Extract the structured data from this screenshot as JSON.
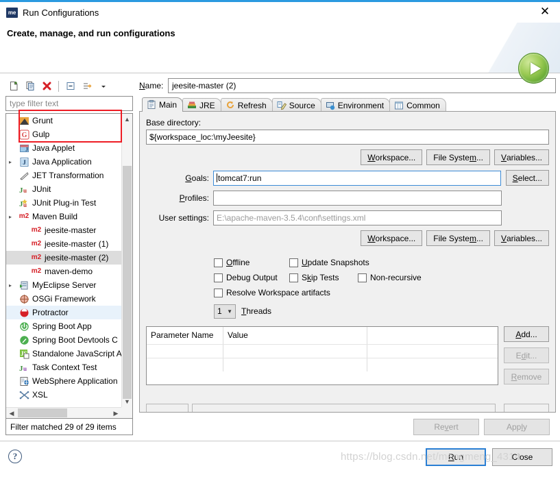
{
  "window": {
    "app_icon": "myeclipse-icon",
    "title": "Run Configurations",
    "close_label": "✕"
  },
  "banner": {
    "heading": "Create, manage, and run configurations",
    "icon": "run-play-icon"
  },
  "left": {
    "toolbar": [
      {
        "name": "new-configuration-button",
        "icon": "new-document-icon"
      },
      {
        "name": "duplicate-configuration-button",
        "icon": "copy-icon"
      },
      {
        "name": "delete-configuration-button",
        "icon": "delete-red-x-icon"
      },
      {
        "name": "collapse-all-button",
        "icon": "collapse-all-icon"
      },
      {
        "name": "filter-configurations-button",
        "icon": "filter-arrow-icon"
      },
      {
        "name": "view-menu-button",
        "icon": "chevron-down-icon"
      }
    ],
    "filter": {
      "placeholder": "type filter text",
      "value": ""
    },
    "tree": [
      {
        "label": "Grunt",
        "icon": "grunt-icon",
        "level": 0,
        "state": "normal"
      },
      {
        "label": "Gulp",
        "icon": "gulp-icon",
        "level": 0,
        "state": "normal"
      },
      {
        "label": "Java Applet",
        "icon": "java-applet-icon",
        "level": 0,
        "state": "normal"
      },
      {
        "label": "Java Application",
        "icon": "java-application-icon",
        "level": 0,
        "state": "normal",
        "expandable": true
      },
      {
        "label": "JET Transformation",
        "icon": "jet-transformation-icon",
        "level": 0,
        "state": "normal"
      },
      {
        "label": "JUnit",
        "icon": "junit-icon",
        "level": 0,
        "state": "normal"
      },
      {
        "label": "JUnit Plug-in Test",
        "icon": "junit-plugin-test-icon",
        "level": 0,
        "state": "normal"
      },
      {
        "label": "Maven Build",
        "icon": "maven-icon",
        "level": 0,
        "state": "normal",
        "expandable": true
      },
      {
        "label": "jeesite-master",
        "icon": "maven-icon",
        "level": 1,
        "state": "normal"
      },
      {
        "label": "jeesite-master (1)",
        "icon": "maven-icon",
        "level": 1,
        "state": "normal"
      },
      {
        "label": "jeesite-master (2)",
        "icon": "maven-icon",
        "level": 1,
        "state": "selected"
      },
      {
        "label": "maven-demo",
        "icon": "maven-icon",
        "level": 1,
        "state": "normal"
      },
      {
        "label": "MyEclipse Server",
        "icon": "myeclipse-server-icon",
        "level": 0,
        "state": "normal",
        "expandable": true
      },
      {
        "label": "OSGi Framework",
        "icon": "osgi-icon",
        "level": 0,
        "state": "normal"
      },
      {
        "label": "Protractor",
        "icon": "protractor-icon",
        "level": 0,
        "state": "hover"
      },
      {
        "label": "Spring Boot App",
        "icon": "spring-boot-icon",
        "level": 0,
        "state": "normal"
      },
      {
        "label": "Spring Boot Devtools C",
        "icon": "spring-boot-devtools-icon",
        "level": 0,
        "state": "normal"
      },
      {
        "label": "Standalone JavaScript A",
        "icon": "javascript-icon",
        "level": 0,
        "state": "normal"
      },
      {
        "label": "Task Context Test",
        "icon": "task-context-test-icon",
        "level": 0,
        "state": "normal"
      },
      {
        "label": "WebSphere Application",
        "icon": "websphere-icon",
        "level": 0,
        "state": "normal"
      },
      {
        "label": "XSL",
        "icon": "xsl-icon",
        "level": 0,
        "state": "normal"
      }
    ],
    "status": "Filter matched 29 of 29 items"
  },
  "right": {
    "name_label": "Name:",
    "name_value": "jeesite-master (2)",
    "tabs": [
      {
        "label": "Main",
        "icon": "main-tab-icon",
        "active": true
      },
      {
        "label": "JRE",
        "icon": "jre-tab-icon",
        "active": false
      },
      {
        "label": "Refresh",
        "icon": "refresh-tab-icon",
        "active": false
      },
      {
        "label": "Source",
        "icon": "source-tab-icon",
        "active": false
      },
      {
        "label": "Environment",
        "icon": "environment-tab-icon",
        "active": false
      },
      {
        "label": "Common",
        "icon": "common-tab-icon",
        "active": false
      }
    ],
    "main": {
      "base_directory_label": "Base directory:",
      "base_directory_value": "${workspace_loc:\\myJeesite}",
      "dir_buttons": [
        {
          "label": "Workspace...",
          "name": "base-workspace-button"
        },
        {
          "label": "File System...",
          "name": "base-file-system-button"
        },
        {
          "label": "Variables...",
          "name": "base-variables-button"
        }
      ],
      "goals_label": "Goals:",
      "goals_value": "tomcat7:run",
      "goals_select_label": "Select...",
      "profiles_label": "Profiles:",
      "profiles_value": "",
      "user_settings_label": "User settings:",
      "user_settings_placeholder": "E:\\apache-maven-3.5.4\\conf\\settings.xml",
      "settings_buttons": [
        {
          "label": "Workspace...",
          "name": "settings-workspace-button"
        },
        {
          "label": "File System...",
          "name": "settings-file-system-button"
        },
        {
          "label": "Variables...",
          "name": "settings-variables-button"
        }
      ],
      "checkboxes": [
        {
          "label": "Offline",
          "checked": false,
          "name": "offline-checkbox"
        },
        {
          "label": "Update Snapshots",
          "checked": false,
          "name": "update-snapshots-checkbox"
        },
        {
          "label": "Debug Output",
          "checked": false,
          "name": "debug-output-checkbox"
        },
        {
          "label": "Skip Tests",
          "checked": false,
          "name": "skip-tests-checkbox"
        },
        {
          "label": "Non-recursive",
          "checked": false,
          "name": "non-recursive-checkbox"
        },
        {
          "label": "Resolve Workspace artifacts",
          "checked": false,
          "name": "resolve-workspace-artifacts-checkbox"
        }
      ],
      "threads_value": "1",
      "threads_label": "Threads",
      "table": {
        "columns": [
          "Parameter Name",
          "Value",
          ""
        ],
        "rows": [],
        "empty_row_count": 2
      },
      "table_buttons": [
        {
          "label": "Add...",
          "enabled": true,
          "name": "add-parameter-button"
        },
        {
          "label": "Edit...",
          "enabled": false,
          "name": "edit-parameter-button"
        },
        {
          "label": "Remove",
          "enabled": false,
          "name": "remove-parameter-button"
        }
      ]
    },
    "revert_label": "Revert",
    "revert_enabled": false,
    "apply_label": "Apply",
    "apply_enabled": false
  },
  "footer": {
    "help_icon": "help-question-icon",
    "run_label": "Run",
    "close_label": "Close"
  },
  "watermark": "https://blog.csdn.net/mengmeng_4314",
  "colors": {
    "accent": "#2b9ae0",
    "panel": "#f0f0f0",
    "annotation_red": "#ee1c24",
    "run_green": "#63a832"
  }
}
